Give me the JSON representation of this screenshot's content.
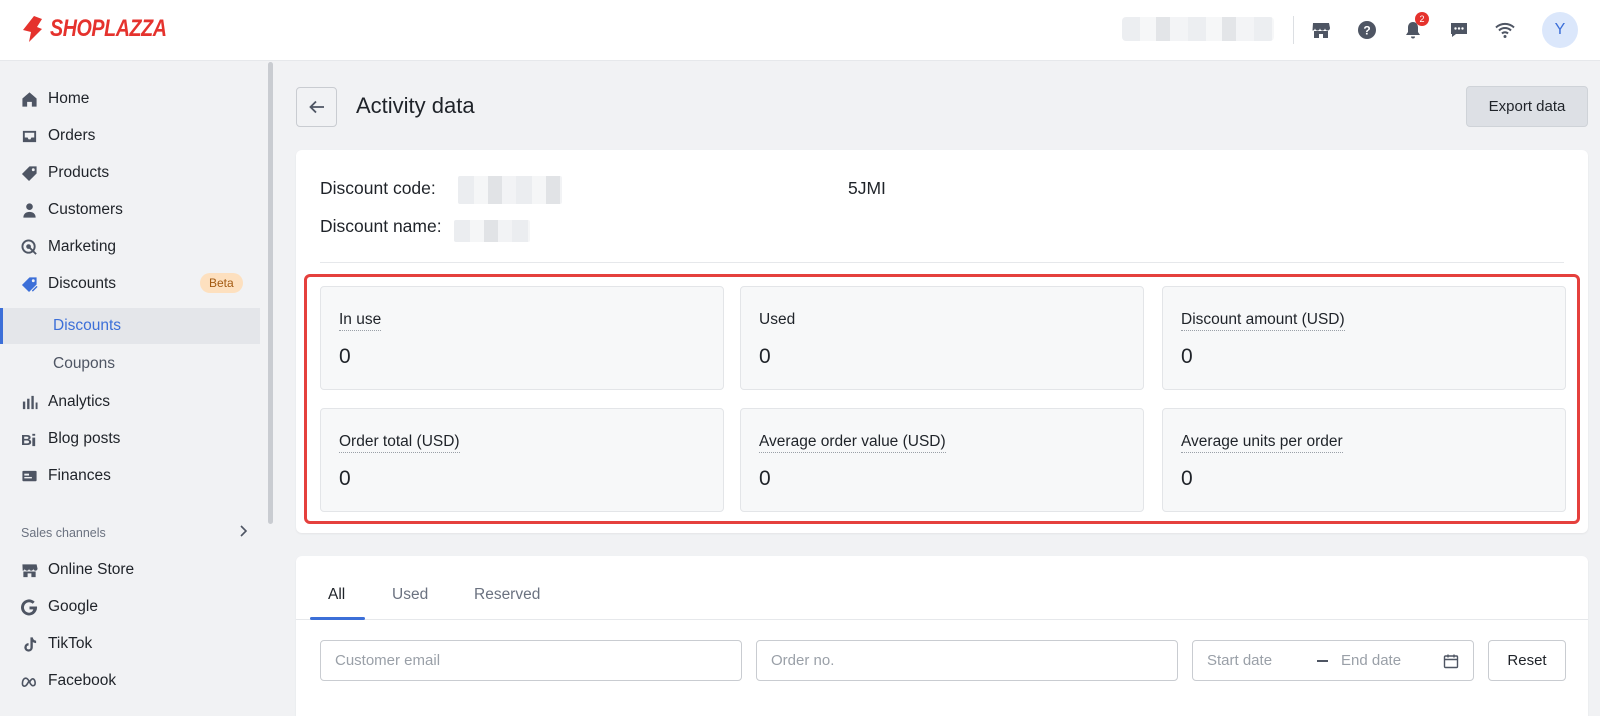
{
  "app": {
    "brand": "SHOPLAZZA"
  },
  "topbar": {
    "notification_count": "2",
    "avatar_initial": "Y",
    "icons": [
      "store-icon",
      "help-icon",
      "bell-icon",
      "message-icon",
      "wifi-icon"
    ]
  },
  "sidebar": {
    "items": [
      {
        "label": "Home",
        "icon": "home-icon"
      },
      {
        "label": "Orders",
        "icon": "inbox-icon"
      },
      {
        "label": "Products",
        "icon": "tag-icon"
      },
      {
        "label": "Customers",
        "icon": "person-icon"
      },
      {
        "label": "Marketing",
        "icon": "target-icon"
      },
      {
        "label": "Discounts",
        "icon": "discount-tag-icon",
        "badge": "Beta"
      },
      {
        "label": "Analytics",
        "icon": "bar-chart-icon"
      },
      {
        "label": "Blog posts",
        "icon": "blog-icon"
      },
      {
        "label": "Finances",
        "icon": "finance-icon"
      }
    ],
    "sub_items": [
      {
        "label": "Discounts",
        "active": true
      },
      {
        "label": "Coupons",
        "active": false
      }
    ],
    "sales_channels_label": "Sales channels",
    "channels": [
      {
        "label": "Online Store",
        "icon": "store-icon"
      },
      {
        "label": "Google",
        "icon": "google-icon"
      },
      {
        "label": "TikTok",
        "icon": "tiktok-icon"
      },
      {
        "label": "Facebook",
        "icon": "meta-icon"
      }
    ],
    "active_color": "#3c6fd8"
  },
  "page": {
    "title": "Activity data",
    "export_label": "Export data"
  },
  "discount": {
    "code_label": "Discount code:",
    "code_visible_tail": "5JMI",
    "name_label": "Discount name:"
  },
  "stats": [
    {
      "label": "In use",
      "value": "0"
    },
    {
      "label": "Used",
      "value": "0"
    },
    {
      "label": "Discount amount (USD)",
      "value": "0"
    },
    {
      "label": "Order total (USD)",
      "value": "0"
    },
    {
      "label": "Average order value (USD)",
      "value": "0"
    },
    {
      "label": "Average units per order",
      "value": "0"
    }
  ],
  "highlight_color": "#e5403d",
  "tabs": [
    {
      "label": "All",
      "active": true
    },
    {
      "label": "Used",
      "active": false
    },
    {
      "label": "Reserved",
      "active": false
    }
  ],
  "filters": {
    "email_placeholder": "Customer email",
    "order_placeholder": "Order no.",
    "start_placeholder": "Start date",
    "end_placeholder": "End date",
    "reset_label": "Reset"
  }
}
